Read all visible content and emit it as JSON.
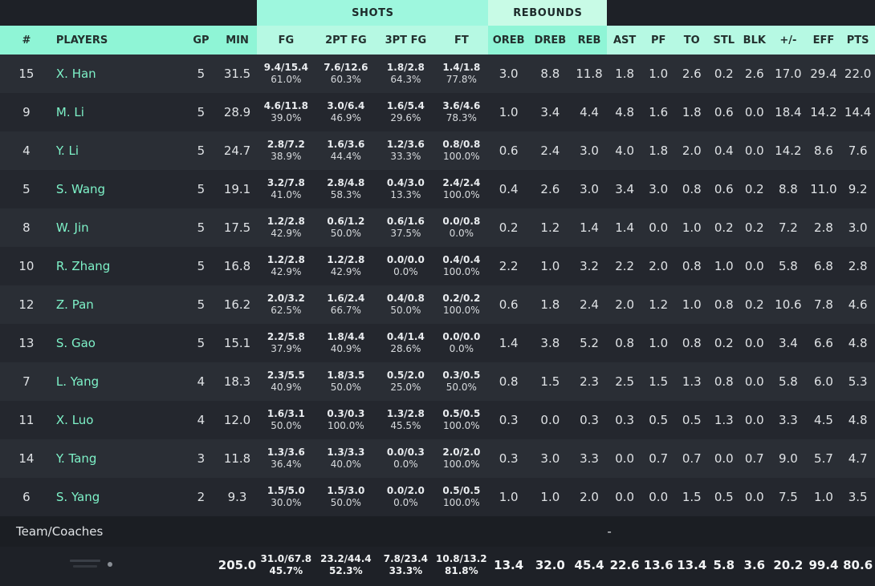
{
  "groups": {
    "shots": "SHOTS",
    "rebounds": "REBOUNDS"
  },
  "headers": {
    "num": "#",
    "players": "PLAYERS",
    "gp": "GP",
    "min": "MIN",
    "fg": "FG",
    "fg2": "2PT FG",
    "fg3": "3PT FG",
    "ft": "FT",
    "oreb": "OREB",
    "dreb": "DREB",
    "reb": "REB",
    "ast": "AST",
    "pf": "PF",
    "to": "TO",
    "stl": "STL",
    "blk": "BLK",
    "pm": "+/-",
    "eff": "EFF",
    "pts": "PTS"
  },
  "players": [
    {
      "num": "15",
      "name": "X. Han",
      "gp": "5",
      "min": "31.5",
      "fg": "9.4/15.4",
      "fg_pct": "61.0%",
      "fg2": "7.6/12.6",
      "fg2_pct": "60.3%",
      "fg3": "1.8/2.8",
      "fg3_pct": "64.3%",
      "ft": "1.4/1.8",
      "ft_pct": "77.8%",
      "oreb": "3.0",
      "dreb": "8.8",
      "reb": "11.8",
      "ast": "1.8",
      "pf": "1.0",
      "to": "2.6",
      "stl": "0.2",
      "blk": "2.6",
      "pm": "17.0",
      "eff": "29.4",
      "pts": "22.0"
    },
    {
      "num": "9",
      "name": "M. Li",
      "gp": "5",
      "min": "28.9",
      "fg": "4.6/11.8",
      "fg_pct": "39.0%",
      "fg2": "3.0/6.4",
      "fg2_pct": "46.9%",
      "fg3": "1.6/5.4",
      "fg3_pct": "29.6%",
      "ft": "3.6/4.6",
      "ft_pct": "78.3%",
      "oreb": "1.0",
      "dreb": "3.4",
      "reb": "4.4",
      "ast": "4.8",
      "pf": "1.6",
      "to": "1.8",
      "stl": "0.6",
      "blk": "0.0",
      "pm": "18.4",
      "eff": "14.2",
      "pts": "14.4"
    },
    {
      "num": "4",
      "name": "Y. Li",
      "gp": "5",
      "min": "24.7",
      "fg": "2.8/7.2",
      "fg_pct": "38.9%",
      "fg2": "1.6/3.6",
      "fg2_pct": "44.4%",
      "fg3": "1.2/3.6",
      "fg3_pct": "33.3%",
      "ft": "0.8/0.8",
      "ft_pct": "100.0%",
      "oreb": "0.6",
      "dreb": "2.4",
      "reb": "3.0",
      "ast": "4.0",
      "pf": "1.8",
      "to": "2.0",
      "stl": "0.4",
      "blk": "0.0",
      "pm": "14.2",
      "eff": "8.6",
      "pts": "7.6"
    },
    {
      "num": "5",
      "name": "S. Wang",
      "gp": "5",
      "min": "19.1",
      "fg": "3.2/7.8",
      "fg_pct": "41.0%",
      "fg2": "2.8/4.8",
      "fg2_pct": "58.3%",
      "fg3": "0.4/3.0",
      "fg3_pct": "13.3%",
      "ft": "2.4/2.4",
      "ft_pct": "100.0%",
      "oreb": "0.4",
      "dreb": "2.6",
      "reb": "3.0",
      "ast": "3.4",
      "pf": "3.0",
      "to": "0.8",
      "stl": "0.6",
      "blk": "0.2",
      "pm": "8.8",
      "eff": "11.0",
      "pts": "9.2"
    },
    {
      "num": "8",
      "name": "W. Jin",
      "gp": "5",
      "min": "17.5",
      "fg": "1.2/2.8",
      "fg_pct": "42.9%",
      "fg2": "0.6/1.2",
      "fg2_pct": "50.0%",
      "fg3": "0.6/1.6",
      "fg3_pct": "37.5%",
      "ft": "0.0/0.8",
      "ft_pct": "0.0%",
      "oreb": "0.2",
      "dreb": "1.2",
      "reb": "1.4",
      "ast": "1.4",
      "pf": "0.0",
      "to": "1.0",
      "stl": "0.2",
      "blk": "0.2",
      "pm": "7.2",
      "eff": "2.8",
      "pts": "3.0"
    },
    {
      "num": "10",
      "name": "R. Zhang",
      "gp": "5",
      "min": "16.8",
      "fg": "1.2/2.8",
      "fg_pct": "42.9%",
      "fg2": "1.2/2.8",
      "fg2_pct": "42.9%",
      "fg3": "0.0/0.0",
      "fg3_pct": "0.0%",
      "ft": "0.4/0.4",
      "ft_pct": "100.0%",
      "oreb": "2.2",
      "dreb": "1.0",
      "reb": "3.2",
      "ast": "2.2",
      "pf": "2.0",
      "to": "0.8",
      "stl": "1.0",
      "blk": "0.0",
      "pm": "5.8",
      "eff": "6.8",
      "pts": "2.8"
    },
    {
      "num": "12",
      "name": "Z. Pan",
      "gp": "5",
      "min": "16.2",
      "fg": "2.0/3.2",
      "fg_pct": "62.5%",
      "fg2": "1.6/2.4",
      "fg2_pct": "66.7%",
      "fg3": "0.4/0.8",
      "fg3_pct": "50.0%",
      "ft": "0.2/0.2",
      "ft_pct": "100.0%",
      "oreb": "0.6",
      "dreb": "1.8",
      "reb": "2.4",
      "ast": "2.0",
      "pf": "1.2",
      "to": "1.0",
      "stl": "0.8",
      "blk": "0.2",
      "pm": "10.6",
      "eff": "7.8",
      "pts": "4.6"
    },
    {
      "num": "13",
      "name": "S. Gao",
      "gp": "5",
      "min": "15.1",
      "fg": "2.2/5.8",
      "fg_pct": "37.9%",
      "fg2": "1.8/4.4",
      "fg2_pct": "40.9%",
      "fg3": "0.4/1.4",
      "fg3_pct": "28.6%",
      "ft": "0.0/0.0",
      "ft_pct": "0.0%",
      "oreb": "1.4",
      "dreb": "3.8",
      "reb": "5.2",
      "ast": "0.8",
      "pf": "1.0",
      "to": "0.8",
      "stl": "0.2",
      "blk": "0.0",
      "pm": "3.4",
      "eff": "6.6",
      "pts": "4.8"
    },
    {
      "num": "7",
      "name": "L. Yang",
      "gp": "4",
      "min": "18.3",
      "fg": "2.3/5.5",
      "fg_pct": "40.9%",
      "fg2": "1.8/3.5",
      "fg2_pct": "50.0%",
      "fg3": "0.5/2.0",
      "fg3_pct": "25.0%",
      "ft": "0.3/0.5",
      "ft_pct": "50.0%",
      "oreb": "0.8",
      "dreb": "1.5",
      "reb": "2.3",
      "ast": "2.5",
      "pf": "1.5",
      "to": "1.3",
      "stl": "0.8",
      "blk": "0.0",
      "pm": "5.8",
      "eff": "6.0",
      "pts": "5.3"
    },
    {
      "num": "11",
      "name": "X. Luo",
      "gp": "4",
      "min": "12.0",
      "fg": "1.6/3.1",
      "fg_pct": "50.0%",
      "fg2": "0.3/0.3",
      "fg2_pct": "100.0%",
      "fg3": "1.3/2.8",
      "fg3_pct": "45.5%",
      "ft": "0.5/0.5",
      "ft_pct": "100.0%",
      "oreb": "0.3",
      "dreb": "0.0",
      "reb": "0.3",
      "ast": "0.3",
      "pf": "0.5",
      "to": "0.5",
      "stl": "1.3",
      "blk": "0.0",
      "pm": "3.3",
      "eff": "4.5",
      "pts": "4.8"
    },
    {
      "num": "14",
      "name": "Y. Tang",
      "gp": "3",
      "min": "11.8",
      "fg": "1.3/3.6",
      "fg_pct": "36.4%",
      "fg2": "1.3/3.3",
      "fg2_pct": "40.0%",
      "fg3": "0.0/0.3",
      "fg3_pct": "0.0%",
      "ft": "2.0/2.0",
      "ft_pct": "100.0%",
      "oreb": "0.3",
      "dreb": "3.0",
      "reb": "3.3",
      "ast": "0.0",
      "pf": "0.7",
      "to": "0.7",
      "stl": "0.0",
      "blk": "0.7",
      "pm": "9.0",
      "eff": "5.7",
      "pts": "4.7"
    },
    {
      "num": "6",
      "name": "S. Yang",
      "gp": "2",
      "min": "9.3",
      "fg": "1.5/5.0",
      "fg_pct": "30.0%",
      "fg2": "1.5/3.0",
      "fg2_pct": "50.0%",
      "fg3": "0.0/2.0",
      "fg3_pct": "0.0%",
      "ft": "0.5/0.5",
      "ft_pct": "100.0%",
      "oreb": "1.0",
      "dreb": "1.0",
      "reb": "2.0",
      "ast": "0.0",
      "pf": "0.0",
      "to": "1.5",
      "stl": "0.5",
      "blk": "0.0",
      "pm": "7.5",
      "eff": "1.0",
      "pts": "3.5"
    }
  ],
  "team": {
    "label": "Team/Coaches",
    "dash": "-"
  },
  "totals": {
    "min": "205.0",
    "fg": "31.0/67.8",
    "fg_pct": "45.7%",
    "fg2": "23.2/44.4",
    "fg2_pct": "52.3%",
    "fg3": "7.8/23.4",
    "fg3_pct": "33.3%",
    "ft": "10.8/13.2",
    "ft_pct": "81.8%",
    "oreb": "13.4",
    "dreb": "32.0",
    "reb": "45.4",
    "ast": "22.6",
    "pf": "13.6",
    "to": "13.4",
    "stl": "5.8",
    "blk": "3.6",
    "pm": "20.2",
    "eff": "99.4",
    "pts": "80.6"
  },
  "icons": {
    "footer_logo": "watermark-logo-icon"
  },
  "colors": {
    "header": "#8ff5d6",
    "player_name": "#7ef2c8",
    "row_odd": "#2a2e35",
    "row_even": "#24272e"
  }
}
